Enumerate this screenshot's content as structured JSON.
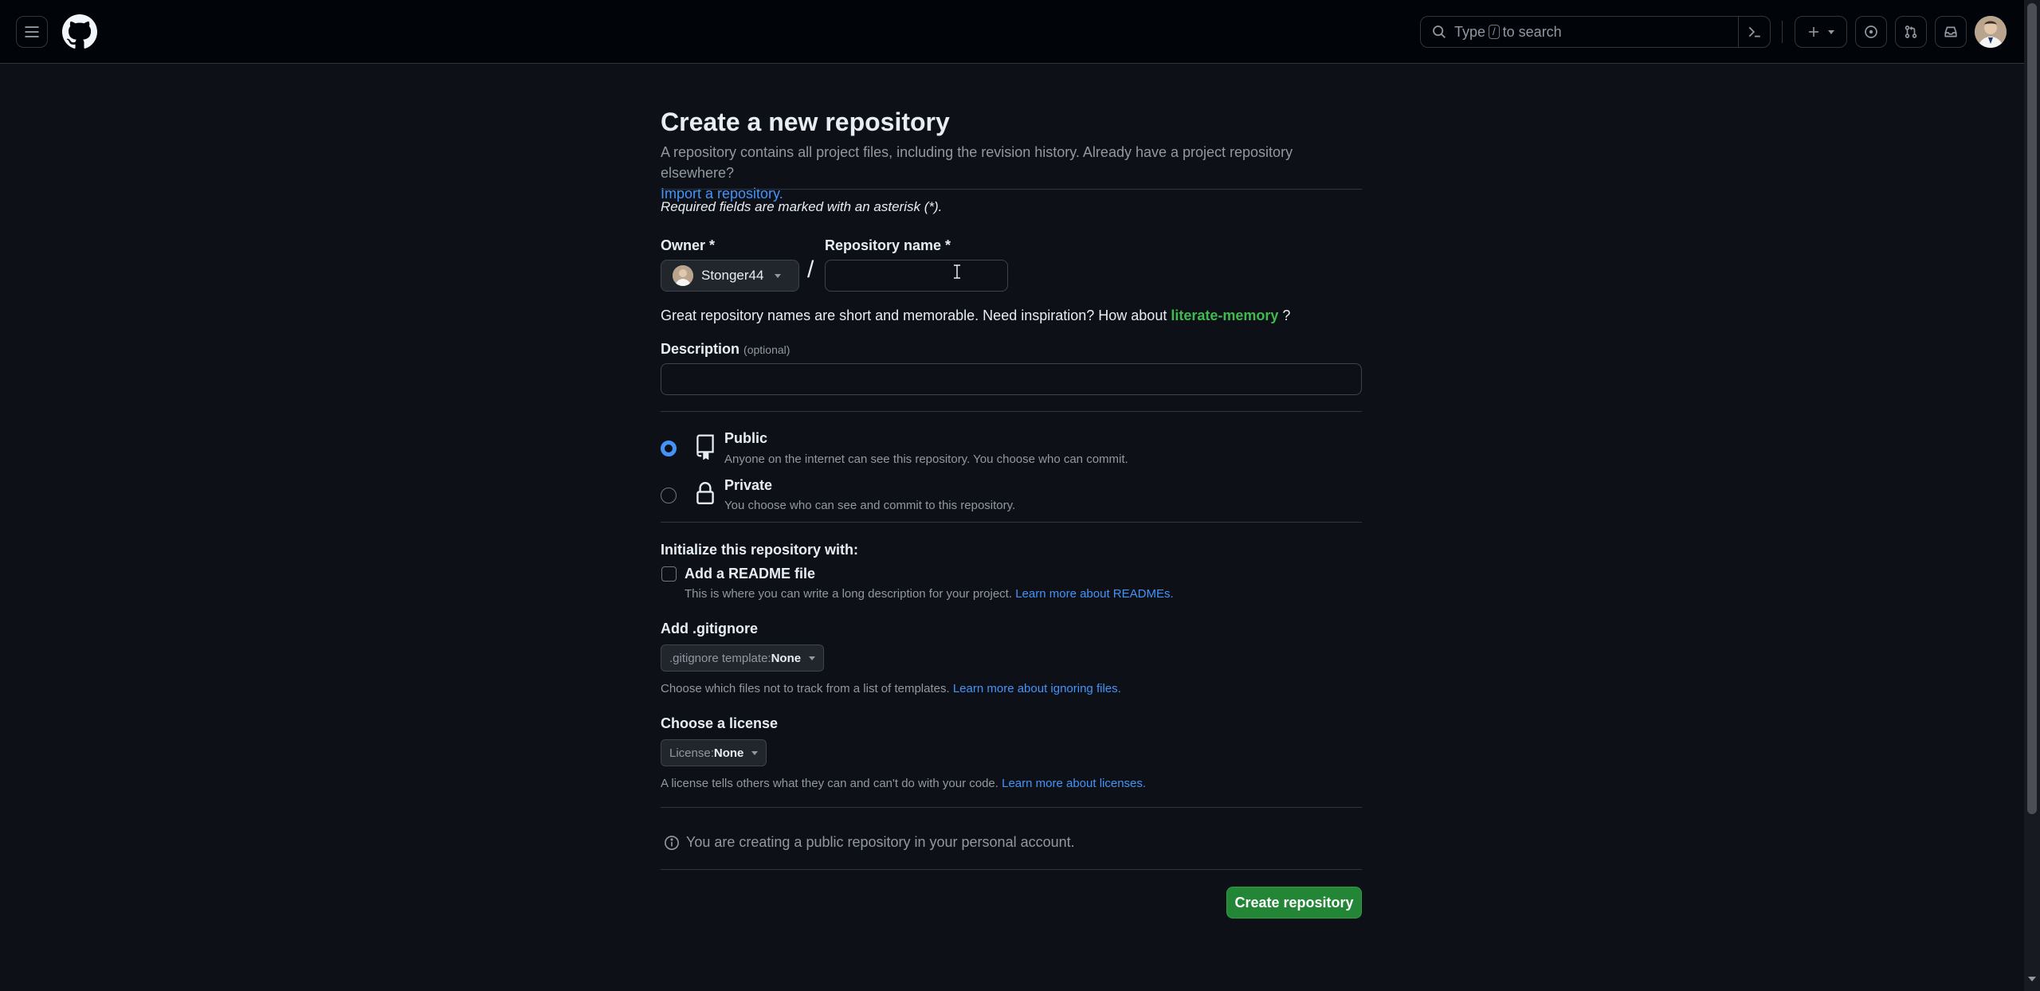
{
  "header": {
    "search_placeholder_pre": "Type",
    "search_key": "/",
    "search_placeholder_post": "to search"
  },
  "page": {
    "title": "Create a new repository",
    "subtitle": "A repository contains all project files, including the revision history. Already have a project repository elsewhere?",
    "import_link": "Import a repository.",
    "required_note": "Required fields are marked with an asterisk (*)."
  },
  "owner": {
    "label": "Owner *",
    "value": "Stonger44"
  },
  "repo_name": {
    "label": "Repository name *",
    "value": ""
  },
  "inspiration": {
    "text": "Great repository names are short and memorable. Need inspiration? How about",
    "suggestion": "literate-memory",
    "suffix": "?"
  },
  "description": {
    "label": "Description",
    "optional": "(optional)",
    "value": ""
  },
  "visibility": {
    "public_title": "Public",
    "public_desc": "Anyone on the internet can see this repository. You choose who can commit.",
    "private_title": "Private",
    "private_desc": "You choose who can see and commit to this repository.",
    "selected": "Public"
  },
  "init": {
    "heading": "Initialize this repository with:",
    "readme_label": "Add a README file",
    "readme_desc": "This is where you can write a long description for your project.",
    "readme_link": "Learn more about READMEs.",
    "readme_checked": false
  },
  "gitignore": {
    "heading": "Add .gitignore",
    "button_prefix": ".gitignore template:",
    "button_value": "None",
    "desc": "Choose which files not to track from a list of templates.",
    "link": "Learn more about ignoring files."
  },
  "license": {
    "heading": "Choose a license",
    "button_prefix": "License:",
    "button_value": "None",
    "desc": "A license tells others what they can and can't do with your code.",
    "link": "Learn more about licenses."
  },
  "footer": {
    "info": "You are creating a public repository in your personal account.",
    "create_button": "Create repository"
  },
  "colors": {
    "background": "#0d1117",
    "header_bg": "#010409",
    "accent_blue": "#4493f8",
    "success_green": "#238636",
    "suggestion_green": "#3fb950"
  }
}
